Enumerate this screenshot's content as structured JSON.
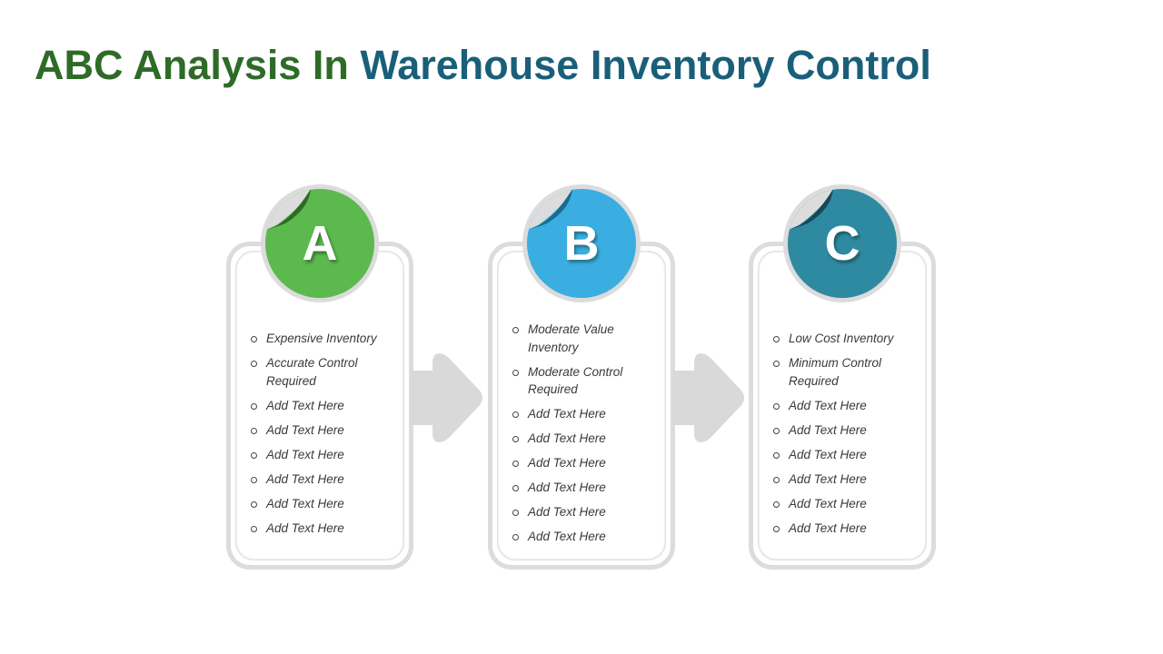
{
  "title": {
    "part1": "ABC Analysis In",
    "part2": "Warehouse Inventory Control",
    "color1": "#2e6b27",
    "color2": "#1a5f7a"
  },
  "cards": [
    {
      "letter": "A",
      "color": "#5cb94e",
      "curl_color": "#2f6b25",
      "items": [
        "Expensive Inventory",
        "Accurate Control Required",
        "Add Text Here",
        "Add Text Here",
        "Add Text Here",
        "Add Text Here",
        "Add Text Here",
        "Add Text Here"
      ]
    },
    {
      "letter": "B",
      "color": "#3aaee0",
      "curl_color": "#1c6b90",
      "items": [
        "Moderate Value Inventory",
        "Moderate Control Required",
        "Add Text Here",
        "Add Text Here",
        "Add Text Here",
        "Add Text Here",
        "Add Text Here",
        "Add Text Here"
      ]
    },
    {
      "letter": "C",
      "color": "#2e8aa0",
      "curl_color": "#15495a",
      "items": [
        "Low Cost Inventory",
        "Minimum Control Required",
        "Add Text Here",
        "Add Text Here",
        "Add Text Here",
        "Add Text Here",
        "Add Text Here",
        "Add Text Here"
      ]
    }
  ],
  "arrow_icon": "right-arrow-icon"
}
